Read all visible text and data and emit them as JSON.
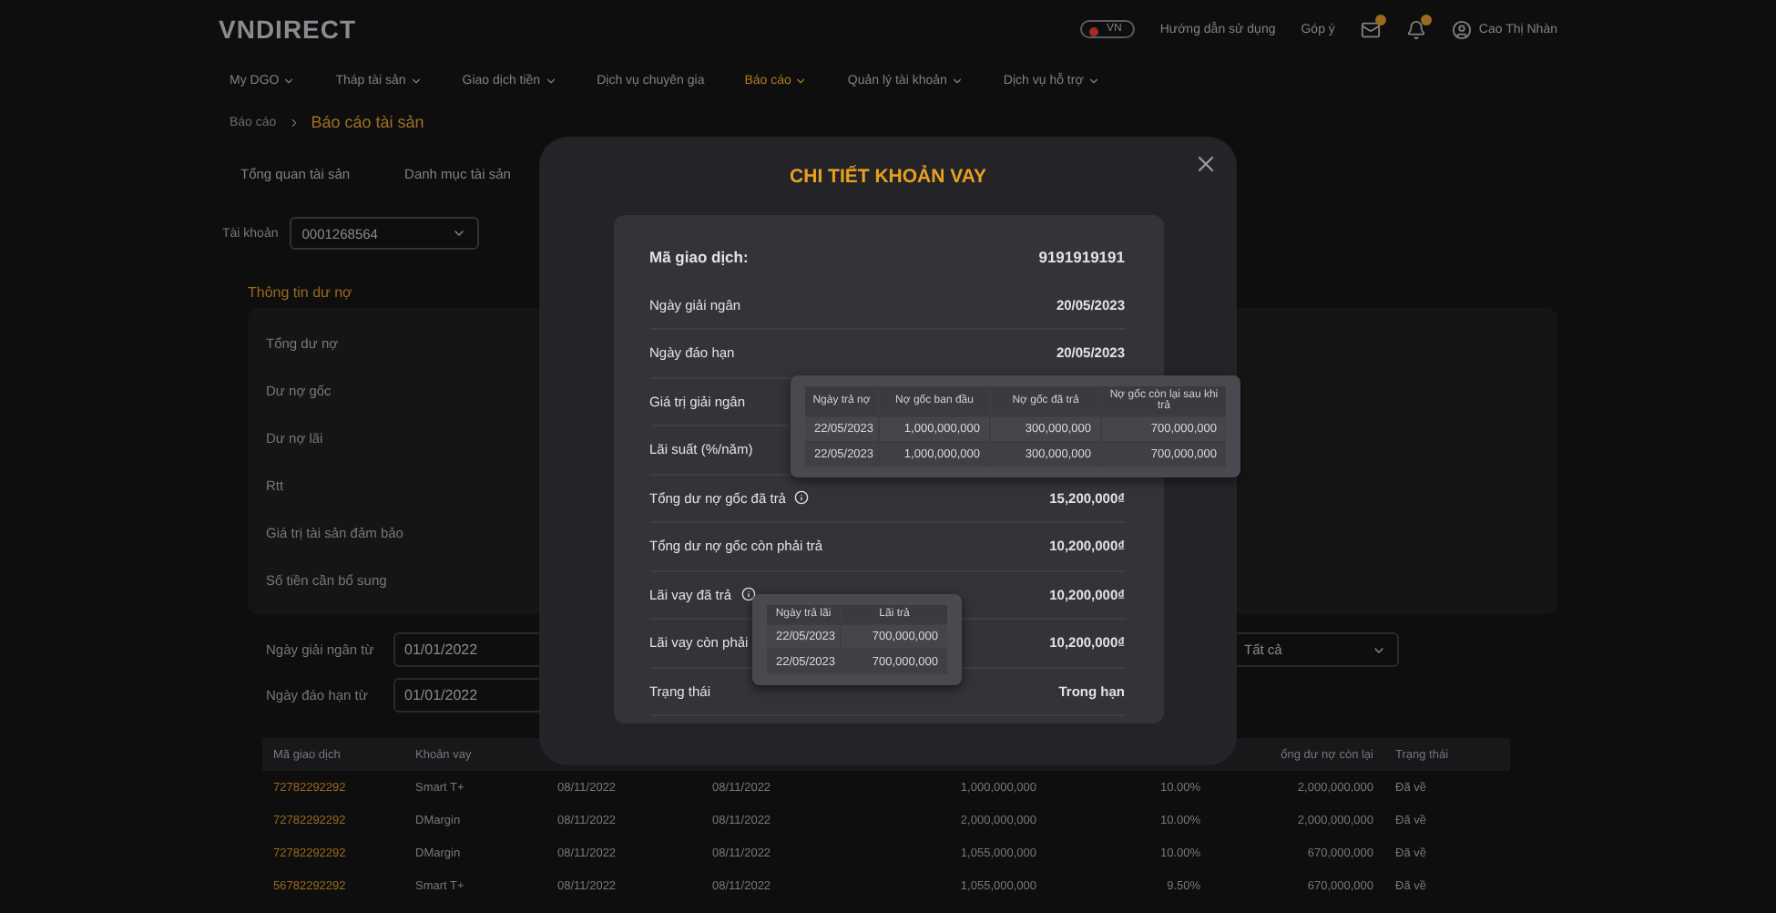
{
  "header": {
    "logo": "VNDIRECT",
    "language": "VN",
    "links": [
      "Hướng dẫn sử dụng",
      "Góp ý"
    ],
    "user": "Cao Thị Nhàn"
  },
  "nav": [
    {
      "label": "My DGO",
      "dropdown": true,
      "selected": false
    },
    {
      "label": "Tháp tài sản",
      "dropdown": true,
      "selected": false
    },
    {
      "label": "Giao dịch tiền",
      "dropdown": true,
      "selected": false
    },
    {
      "label": "Dịch vụ chuyên gia",
      "dropdown": false,
      "selected": false
    },
    {
      "label": "Báo cáo",
      "dropdown": true,
      "selected": true
    },
    {
      "label": "Quản lý tài khoản",
      "dropdown": true,
      "selected": false
    },
    {
      "label": "Dịch vụ hỗ trợ",
      "dropdown": true,
      "selected": false
    }
  ],
  "breadcrumb": [
    "Báo cáo",
    "Báo cáo tài sản"
  ],
  "tabs": [
    {
      "label": "Tổng quan tài sản",
      "selected": false
    },
    {
      "label": "Danh mục tài sản",
      "selected": false
    }
  ],
  "account": {
    "label": "Tài khoản",
    "value": "0001268564"
  },
  "debt_info": {
    "title": "Thông tin dư nợ",
    "items": [
      "Tổng dư nợ",
      "Dư nợ gốc",
      "Dư nợ lãi",
      "Rtt",
      "Giá trị tài sản đảm bảo",
      "Số tiền cần bổ sung"
    ]
  },
  "filters": [
    {
      "label": "Ngày giải ngân từ",
      "value": "01/01/2022"
    },
    {
      "label": "Ngày đáo hạn  từ",
      "value": "01/01/2022"
    }
  ],
  "status_filter": {
    "value": "Tất cả"
  },
  "table": {
    "columns": [
      {
        "label": "Mã giao dịch"
      },
      {
        "label": "Khoản vay"
      },
      {},
      {},
      {},
      {},
      {
        "label": "ổng dư nợ còn lại"
      },
      {
        "label": "Trạng thái"
      }
    ],
    "rows": [
      [
        "72782292292",
        "Smart T+",
        "08/11/2022",
        "08/11/2022",
        "1,000,000,000",
        "10.00%",
        "2,000,000,000",
        "Đã về"
      ],
      [
        "72782292292",
        "DMargin",
        "08/11/2022",
        "08/11/2022",
        "2,000,000,000",
        "10.00%",
        "2,000,000,000",
        "Đã về"
      ],
      [
        "72782292292",
        "DMargin",
        "08/11/2022",
        "08/11/2022",
        "1,055,000,000",
        "10.00%",
        "670,000,000",
        "Đã về"
      ],
      [
        "56782292292",
        "Smart T+",
        "08/11/2022",
        "08/11/2022",
        "1,055,000,000",
        "9.50%",
        "670,000,000",
        "Đã về"
      ]
    ]
  },
  "modal": {
    "title": "CHI TIẾT KHOẢN VAY",
    "code": {
      "label": "Mã giao dịch:",
      "value": "9191919191"
    },
    "rows": [
      {
        "label": "Ngày giải ngân",
        "value": "20/05/2023",
        "info": false
      },
      {
        "label": "Ngày đáo hạn",
        "value": "20/05/2023",
        "info": false
      },
      {
        "label": "Giá trị giải ngân",
        "info": false
      },
      {
        "label": "Lãi suất (%/năm)",
        "info": false
      },
      {
        "label": "Tổng dư nợ gốc đã trả",
        "value": "15,200,000₫",
        "info": true
      },
      {
        "label": "Tổng dư nợ gốc còn phải trả",
        "value": "10,200,000₫",
        "info": false
      },
      {
        "label": "Lãi vay đã trả",
        "value": "10,200,000₫",
        "info": true
      },
      {
        "label": "Lãi vay còn phải",
        "value": "10,200,000₫",
        "info": false
      },
      {
        "label": "Trạng thái",
        "value": "Trong hạn",
        "info": false
      }
    ],
    "principal_popup": {
      "columns": [
        "Ngày trả nợ",
        "Nợ gốc ban đầu",
        "Nợ gốc đã trả",
        "Nợ gốc còn lại sau khi trả"
      ],
      "rows": [
        [
          "22/05/2023",
          "1,000,000,000",
          "300,000,000",
          "700,000,000"
        ],
        [
          "22/05/2023",
          "1,000,000,000",
          "300,000,000",
          "700,000,000"
        ]
      ]
    },
    "interest_popup": {
      "columns": [
        "Ngày trả lãi",
        "Lãi trả"
      ],
      "rows": [
        [
          "22/05/2023",
          "700,000,000"
        ],
        [
          "22/05/2023",
          "700,000,000"
        ]
      ]
    }
  }
}
